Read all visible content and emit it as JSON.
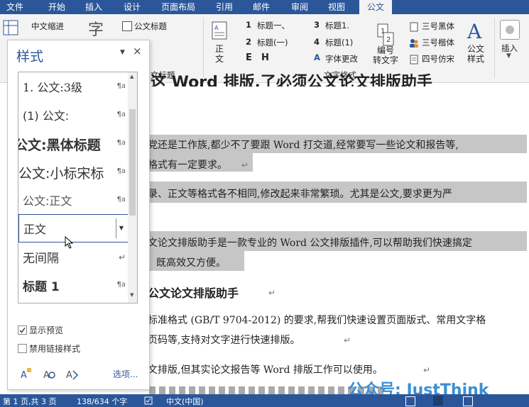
{
  "tabs": [
    "文件",
    "开始",
    "插入",
    "设计",
    "页面布局",
    "引用",
    "邮件",
    "审阅",
    "视图",
    "公文"
  ],
  "ribbon": {
    "cn_indent": "中文缩进",
    "char_icon": "字",
    "gongwen_title": "公文标题",
    "title_partial": "文标题",
    "zhengwen": [
      "正",
      "文"
    ],
    "h1": "标题一、",
    "h2": "标题(一)",
    "h3": "标题1.",
    "h4": "标题(1)",
    "n1": "1",
    "n2": "2",
    "n3": "3",
    "n4": "4",
    "e_btn": "E",
    "h_btn": "H",
    "font_change": "字体更改",
    "num1": "编号",
    "num2": "转文字",
    "font_heiti": "三号黑体",
    "font_kaiti": "三号楷体",
    "font_fangsong": "四号仿宋",
    "style_btn": [
      "公文",
      "样式"
    ],
    "insert_btn": "插入",
    "group_text_format": "文字格式"
  },
  "pane": {
    "title": "样式",
    "items": [
      {
        "text": "1.   公文:3级",
        "mark": "¶a"
      },
      {
        "text": "(1)   公文:",
        "mark": "¶a"
      },
      {
        "text": "公文:黑体标题",
        "mark": "¶a"
      },
      {
        "text": "公文:小标宋标",
        "mark": "¶a"
      },
      {
        "text": "公文:正文",
        "mark": "¶a"
      },
      {
        "text": "正文",
        "mark": ""
      },
      {
        "text": "无间隔",
        "mark": "↵"
      },
      {
        "text": "标题 1",
        "mark": "¶a"
      }
    ],
    "show_preview": "显示预览",
    "disable_linked": "禁用链接样式",
    "options": "选项..."
  },
  "doc": {
    "title_partial": "这 Word 排版,了必须公文论文排版助手",
    "p1a": "党还是工作族,都少不了要跟 Word 打交道,经常要写一些论文和报告等,",
    "p1b": "格式有一定要求。",
    "p2a": "录、正文等格式各不相同,修改起来非常繁琐。尤其是公文,要求更为严",
    "p3a": "文论文排版助手是一款专业的 Word 公文排版插件,可以帮助我们快速搞定",
    "p3b": "既高效又方便。",
    "h2": "公文论文排版助手",
    "p4a": "标准格式 (GB/T 9704-2012) 的要求,帮我们快速设置页面版式、常用文字格",
    "p4b": "页码等,支持对文字进行快速排版。",
    "p5a": "文排版,但其实论文报告等 Word 排版工作可以使用。",
    "watermark": "公众号: JustThink"
  },
  "status": {
    "page": "第 1 页,共 3 页",
    "words": "138/634 个字",
    "lang": "中文(中国)"
  },
  "colors": {
    "brand": "#2b579a",
    "highlight": "#c6c6c6"
  }
}
